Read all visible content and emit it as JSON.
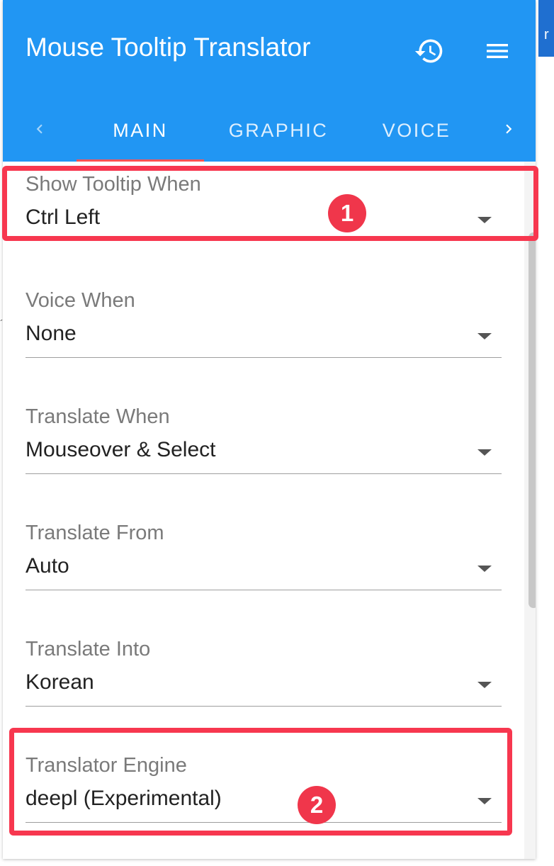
{
  "background": {
    "partial_text": "r"
  },
  "header": {
    "title": "Mouse Tooltip Translator",
    "history_icon": "history-icon",
    "menu_icon": "hamburger-menu-icon",
    "color": "#2196f3"
  },
  "tabs": {
    "items": [
      {
        "label": "MAIN",
        "active": true
      },
      {
        "label": "GRAPHIC",
        "active": false
      },
      {
        "label": "VOICE",
        "active": false
      }
    ],
    "indicator_color": "#ff5252"
  },
  "settings": [
    {
      "label": "Show Tooltip When",
      "value": "Ctrl Left"
    },
    {
      "label": "Voice When",
      "value": "None"
    },
    {
      "label": "Translate When",
      "value": "Mouseover & Select"
    },
    {
      "label": "Translate From",
      "value": "Auto"
    },
    {
      "label": "Translate Into",
      "value": "Korean"
    },
    {
      "label": "Translator Engine",
      "value": "deepl (Experimental)"
    }
  ],
  "annotations": {
    "color": "#f7374f",
    "badges": [
      "1",
      "2"
    ]
  }
}
